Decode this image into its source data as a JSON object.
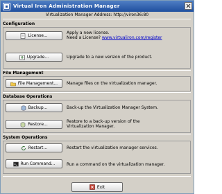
{
  "window": {
    "title": "Virtual Iron Administration Manager"
  },
  "address": {
    "label": "Virtualization Manager Address:",
    "value": "http://viron36:80"
  },
  "configuration": {
    "title": "Configuration",
    "license_button": "License...",
    "license_desc_line1": "Apply a new license.",
    "license_desc_line2_prefix": "Need a License?",
    "license_link": "www.virtualiron.com/register",
    "upgrade_button": "Upgrade...",
    "upgrade_desc": "Upgrade to a new version of the product."
  },
  "file_management": {
    "title": "File Management",
    "button": "File Management...",
    "desc": "Manage files on the virtualization manager."
  },
  "database": {
    "title": "Database Operations",
    "backup_button": "Backup...",
    "backup_desc": "Back-up the Virtualization Manager System.",
    "restore_button": "Restore...",
    "restore_desc_line1": "Restore to a back-up version of the",
    "restore_desc_line2": "Virtualization Manager."
  },
  "system": {
    "title": "System Operations",
    "restart_button": "Restart...",
    "restart_desc": "Restart the virtualization manager services.",
    "run_button": "Run Command...",
    "run_desc": "Run a command on the virtualization manager."
  },
  "footer": {
    "exit_button": "Exit"
  },
  "colors": {
    "title_bar": "#1f4f9e",
    "window_bg": "#d4d0c8",
    "link": "#0000cc"
  },
  "icons": {
    "app": "app-icon",
    "close": "close-icon",
    "license": "license-icon",
    "upgrade": "upgrade-icon",
    "file": "folder-icon",
    "backup": "backup-icon",
    "restore": "restore-icon",
    "restart": "restart-icon",
    "run": "run-command-icon",
    "exit": "exit-icon"
  }
}
